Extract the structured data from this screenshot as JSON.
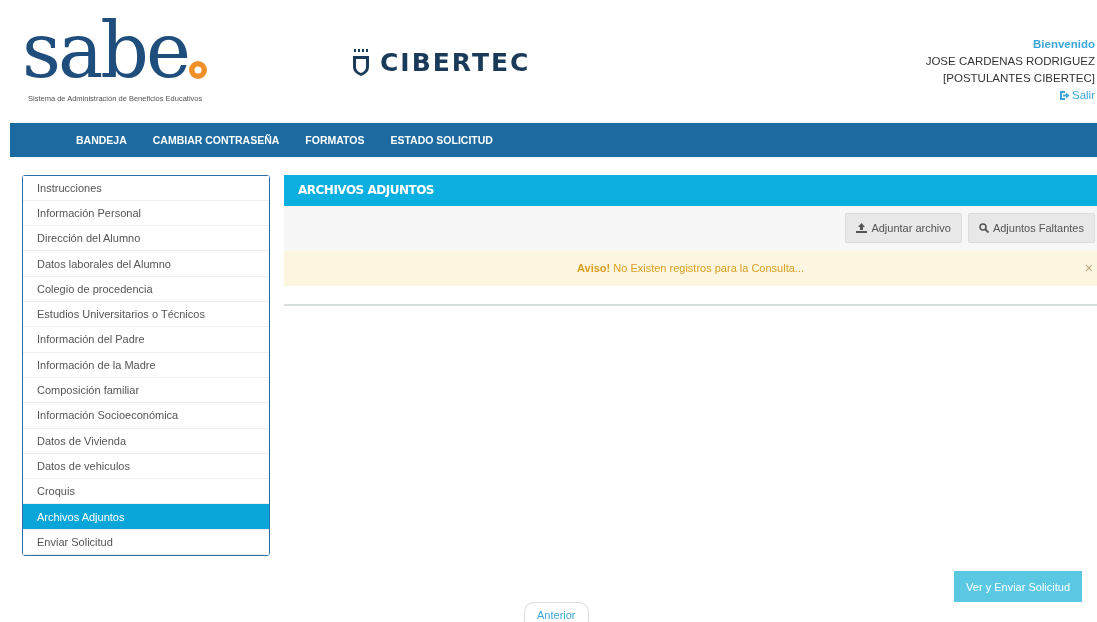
{
  "header": {
    "logo_text": "sabe",
    "logo_subtitle": "Sistema de Administración de Beneficios Educativos",
    "partner": "CIBERTEC",
    "user": {
      "greeting": "Bienvenido",
      "name": "JOSE CARDENAS RODRIGUEZ",
      "group": "[POSTULANTES CIBERTEC]",
      "logout": "Salir"
    }
  },
  "nav": [
    "BANDEJA",
    "CAMBIAR CONTRASEÑA",
    "FORMATOS",
    "ESTADO SOLICITUD"
  ],
  "sidebar": {
    "items": [
      {
        "label": "Instrucciones",
        "selected": false
      },
      {
        "label": "Información Personal",
        "selected": false
      },
      {
        "label": "Dirección del Alumno",
        "selected": false
      },
      {
        "label": "Datos laborales del Alumno",
        "selected": false
      },
      {
        "label": "Colegio de procedencia",
        "selected": false
      },
      {
        "label": "Estudios Universitarios o Técnicos",
        "selected": false
      },
      {
        "label": "Información del Padre",
        "selected": false
      },
      {
        "label": "Información de la Madre",
        "selected": false
      },
      {
        "label": "Composición familiar",
        "selected": false
      },
      {
        "label": "Información Socioeconómica",
        "selected": false
      },
      {
        "label": "Datos de Vivienda",
        "selected": false
      },
      {
        "label": "Datos de vehiculos",
        "selected": false
      },
      {
        "label": "Croquis",
        "selected": false
      },
      {
        "label": "Archivos Adjuntos",
        "selected": true
      },
      {
        "label": "Enviar Solicitud",
        "selected": false
      }
    ]
  },
  "panel": {
    "title": "ARCHIVOS ADJUNTOS",
    "buttons": [
      {
        "kind": "upload",
        "label": "Adjuntar archivo"
      },
      {
        "kind": "search",
        "label": "Adjuntos Faltantes"
      }
    ],
    "alert": {
      "text": "**Aviso!** No Existen registros para la Consulta...",
      "close": "×"
    }
  },
  "footer": {
    "submit": "Ver y Enviar Solicitud",
    "previous": "Anterior"
  }
}
